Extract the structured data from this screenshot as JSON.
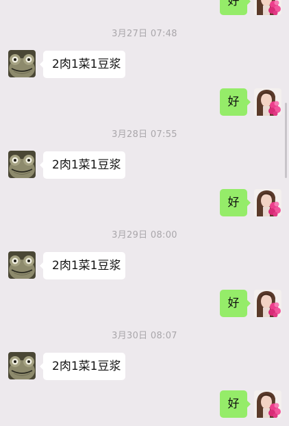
{
  "conversation": {
    "top_reply": "好",
    "groups": [
      {
        "timestamp": "3月27日 07:48",
        "incoming": "2肉1菜1豆浆",
        "outgoing": "好"
      },
      {
        "timestamp": "3月28日 07:55",
        "incoming": "2肉1菜1豆浆",
        "outgoing": "好"
      },
      {
        "timestamp": "3月29日 08:00",
        "incoming": "2肉1菜1豆浆",
        "outgoing": "好"
      },
      {
        "timestamp": "3月30日 08:07",
        "incoming": "2肉1菜1豆浆",
        "outgoing": "好"
      }
    ]
  },
  "avatars": {
    "sender_icon": "frog-avatar-icon",
    "self_icon": "girl-with-flowers-avatar-icon"
  },
  "colors": {
    "background": "#ede9ed",
    "incoming_bubble": "#ffffff",
    "outgoing_bubble": "#95ec69",
    "timestamp_text": "#a9a6aa"
  }
}
